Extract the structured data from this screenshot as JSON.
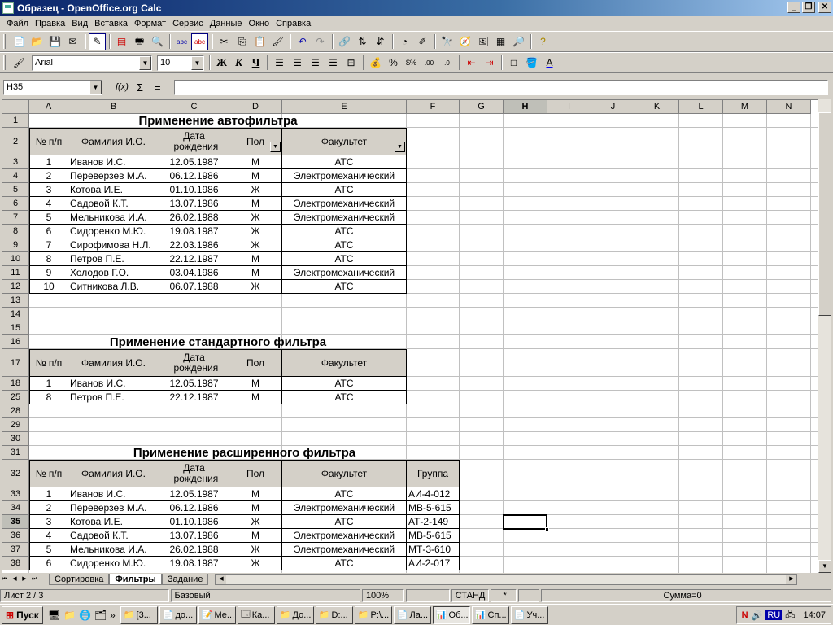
{
  "window": {
    "title": "Образец - OpenOffice.org Calc"
  },
  "menu": [
    "Файл",
    "Правка",
    "Вид",
    "Вставка",
    "Формат",
    "Сервис",
    "Данные",
    "Окно",
    "Справка"
  ],
  "format_toolbar": {
    "font_name": "Arial",
    "font_size": "10",
    "bold": "Ж",
    "italic": "К",
    "underline": "Ч"
  },
  "formula_bar": {
    "cell_ref": "H35",
    "fx": "f(x)",
    "sum": "Σ",
    "equals": "=",
    "content": ""
  },
  "columns": [
    "A",
    "B",
    "C",
    "D",
    "E",
    "F",
    "G",
    "H",
    "I",
    "J",
    "K",
    "L",
    "M",
    "N"
  ],
  "active_column": "H",
  "active_row": "35",
  "rows": [
    "1",
    "2",
    "3",
    "4",
    "5",
    "6",
    "7",
    "8",
    "9",
    "10",
    "11",
    "12",
    "13",
    "14",
    "15",
    "16",
    "17",
    "18",
    "25",
    "28",
    "29",
    "30",
    "31",
    "32",
    "33",
    "34",
    "35",
    "36",
    "37",
    "38"
  ],
  "sections": {
    "autofilter_title": "Применение автофильтра",
    "standard_title": "Применение стандартного фильтра",
    "advanced_title": "Применение расширенного фильтра"
  },
  "headers": {
    "num": "№ п/п",
    "name": "Фамилия И.О.",
    "dob": "Дата рождения",
    "sex": "Пол",
    "faculty": "Факультет",
    "group": "Группа"
  },
  "table1": [
    [
      "1",
      "Иванов И.С.",
      "12.05.1987",
      "М",
      "АТС"
    ],
    [
      "2",
      "Переверзев М.А.",
      "06.12.1986",
      "М",
      "Электромеханический"
    ],
    [
      "3",
      "Котова И.Е.",
      "01.10.1986",
      "Ж",
      "АТС"
    ],
    [
      "4",
      "Садовой К.Т.",
      "13.07.1986",
      "М",
      "Электромеханический"
    ],
    [
      "5",
      "Мельникова И.А.",
      "26.02.1988",
      "Ж",
      "Электромеханический"
    ],
    [
      "6",
      "Сидоренко М.Ю.",
      "19.08.1987",
      "Ж",
      "АТС"
    ],
    [
      "7",
      "Сирофимова Н.Л.",
      "22.03.1986",
      "Ж",
      "АТС"
    ],
    [
      "8",
      "Петров П.Е.",
      "22.12.1987",
      "М",
      "АТС"
    ],
    [
      "9",
      "Холодов Г.О.",
      "03.04.1986",
      "М",
      "Электромеханический"
    ],
    [
      "10",
      "Ситникова Л.В.",
      "06.07.1988",
      "Ж",
      "АТС"
    ]
  ],
  "table2": [
    [
      "1",
      "Иванов И.С.",
      "12.05.1987",
      "М",
      "АТС"
    ],
    [
      "8",
      "Петров П.Е.",
      "22.12.1987",
      "М",
      "АТС"
    ]
  ],
  "table3": [
    [
      "1",
      "Иванов И.С.",
      "12.05.1987",
      "М",
      "АТС",
      "АИ-4-012"
    ],
    [
      "2",
      "Переверзев М.А.",
      "06.12.1986",
      "М",
      "Электромеханический",
      "МВ-5-615"
    ],
    [
      "3",
      "Котова И.Е.",
      "01.10.1986",
      "Ж",
      "АТС",
      "АТ-2-149"
    ],
    [
      "4",
      "Садовой К.Т.",
      "13.07.1986",
      "М",
      "Электромеханический",
      "МВ-5-615"
    ],
    [
      "5",
      "Мельникова И.А.",
      "26.02.1988",
      "Ж",
      "Электромеханический",
      "МТ-3-610"
    ],
    [
      "6",
      "Сидоренко М.Ю.",
      "19.08.1987",
      "Ж",
      "АТС",
      "АИ-2-017"
    ]
  ],
  "sheet_tabs": [
    "Сортировка",
    "Фильтры",
    "Задание"
  ],
  "active_tab": "Фильтры",
  "status": {
    "sheet": "Лист 2 / 3",
    "style": "Базовый",
    "zoom": "100%",
    "mode": "СТАНД",
    "modified": "*",
    "sum": "Сумма=0"
  },
  "taskbar": {
    "start": "Пуск",
    "buttons": [
      "[3...",
      "до...",
      "Ме...",
      "Ка...",
      "До...",
      "D:...",
      "P:\\...",
      "Ла...",
      "Об...",
      "Сп...",
      "Уч..."
    ],
    "active_button": "Об...",
    "lang": "RU",
    "clock": "14:07"
  }
}
